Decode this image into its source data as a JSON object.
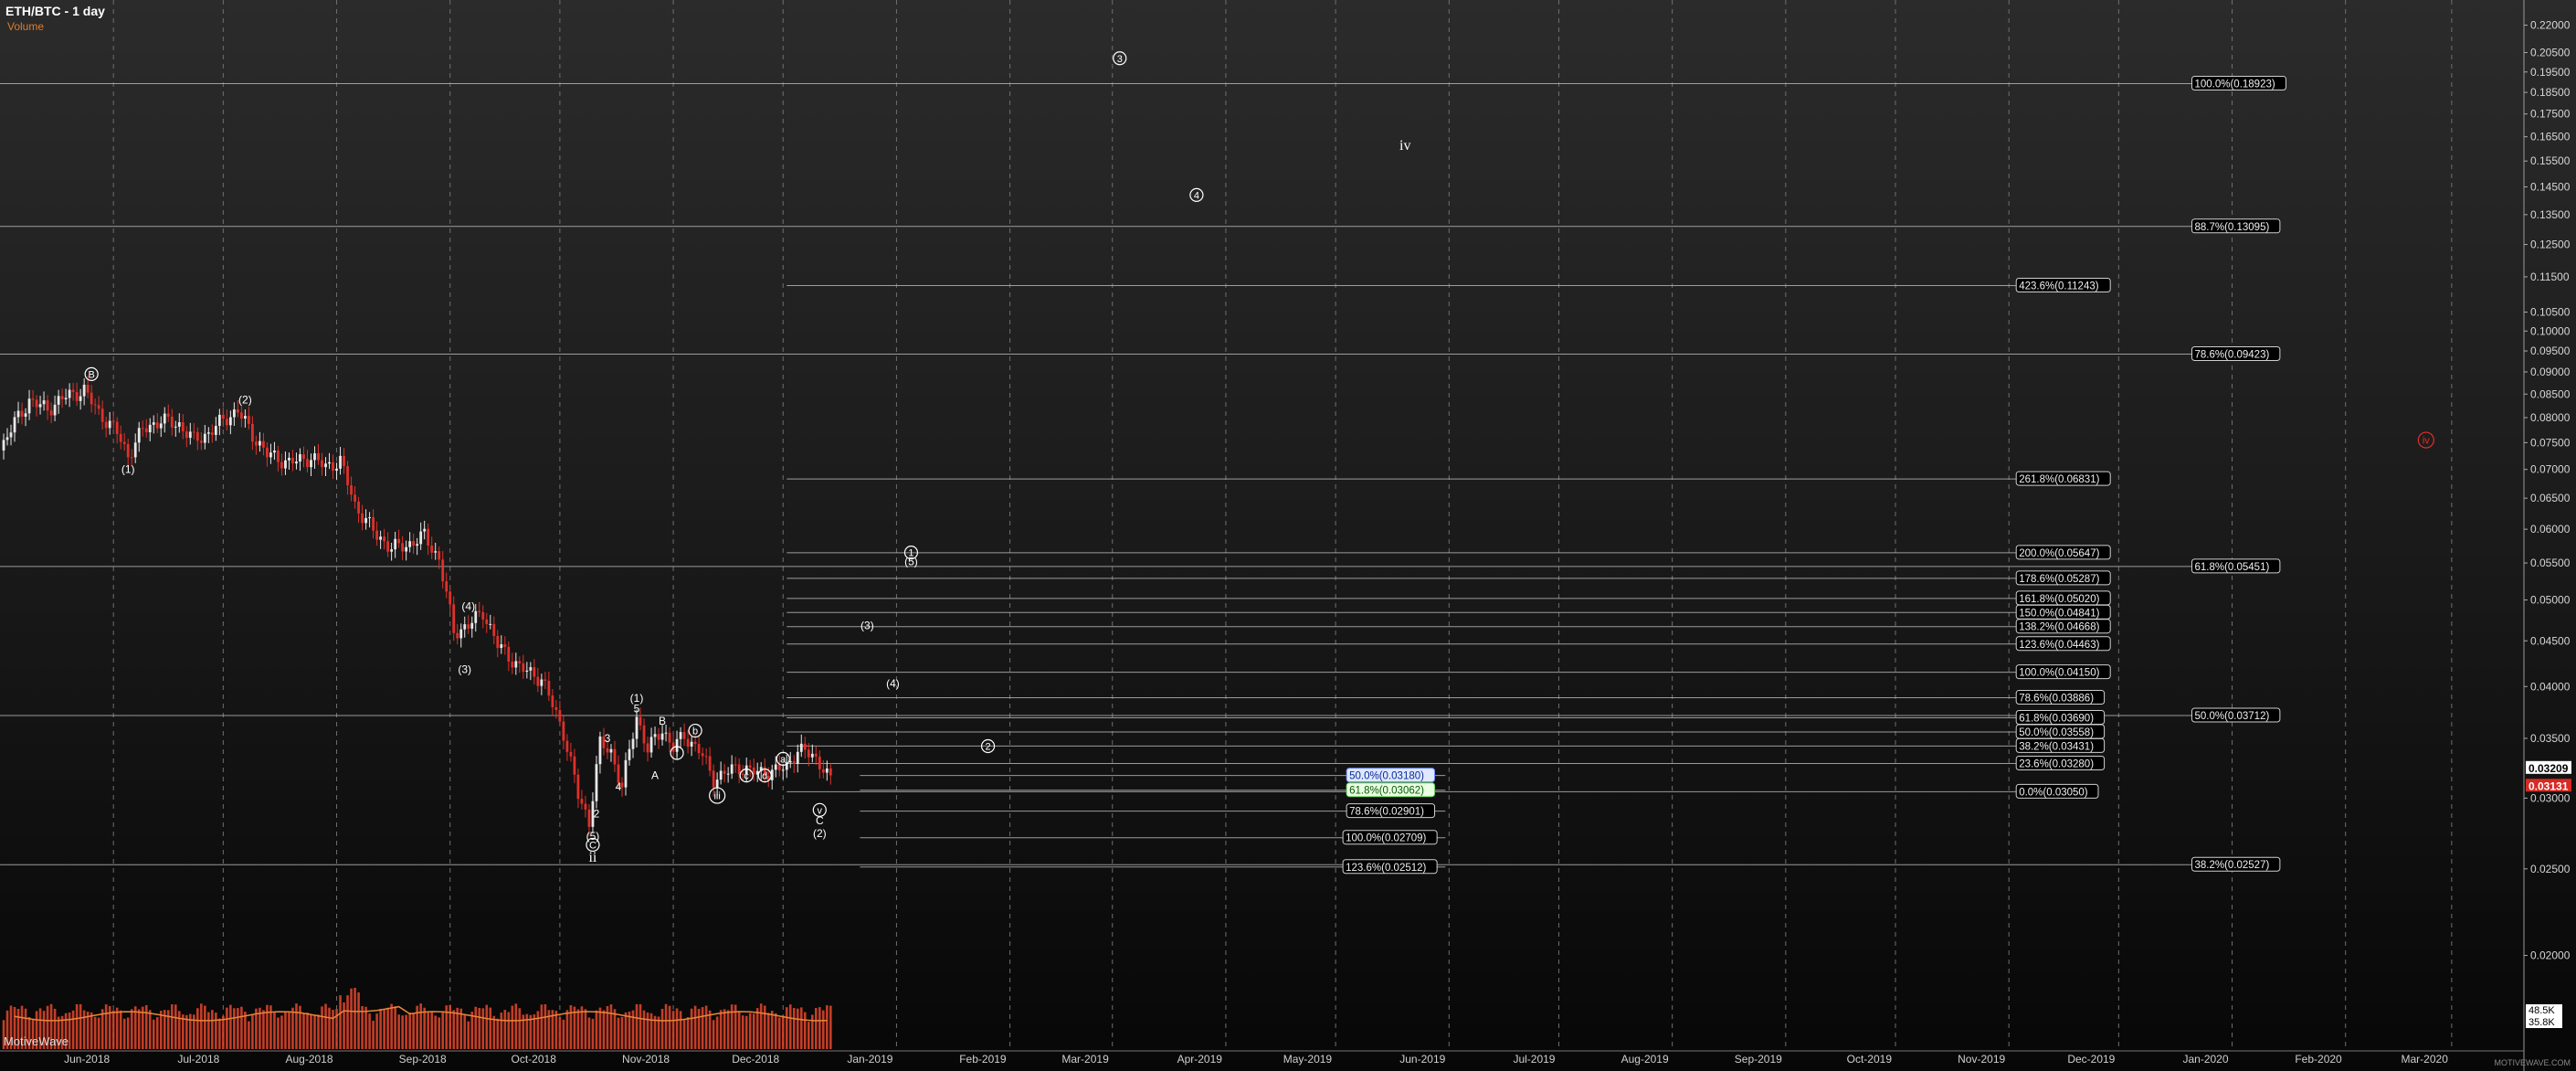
{
  "header": {
    "title": "ETH/BTC - 1 day",
    "volume_label": "Volume"
  },
  "watermark": "MotiveWave",
  "brand": "MOTIVEWAVE.COM",
  "colors": {
    "up": "#e8e8e8",
    "down": "#e0302a",
    "volume": "#d9452b",
    "ma": "#e8873a",
    "grid": "#6f6f6f",
    "fib": "#bdbdbd",
    "red_label": "#e0302a"
  },
  "chart_data": {
    "type": "candlestick",
    "x_axis": {
      "ticks": [
        "Jun-2018",
        "Jul-2018",
        "Aug-2018",
        "Sep-2018",
        "Oct-2018",
        "Nov-2018",
        "Dec-2018",
        "Jan-2019",
        "Feb-2019",
        "Mar-2019",
        "Apr-2019",
        "May-2019",
        "Jun-2019",
        "Jul-2019",
        "Aug-2019",
        "Sep-2019",
        "Oct-2019",
        "Nov-2019",
        "Dec-2019",
        "Jan-2020",
        "Feb-2020",
        "Mar-2020"
      ],
      "range": [
        "2018-05-01",
        "2020-03-20"
      ]
    },
    "y_axis": {
      "scale": "log",
      "range": [
        0.0178,
        0.232
      ],
      "ticks": [
        "0.22000",
        "0.20500",
        "0.19500",
        "0.18500",
        "0.17500",
        "0.16500",
        "0.15500",
        "0.14500",
        "0.13500",
        "0.12500",
        "0.11500",
        "0.10500",
        "0.10000",
        "0.09500",
        "0.09000",
        "0.08500",
        "0.08000",
        "0.07500",
        "0.07000",
        "0.06500",
        "0.06000",
        "0.05500",
        "0.05000",
        "0.04500",
        "0.04000",
        "0.03500",
        "0.03000",
        "0.02500",
        "0.02000"
      ],
      "price_labels": [
        {
          "text": "0.03209",
          "value": 0.03209,
          "style": "white"
        },
        {
          "text": "0.03131",
          "value": 0.03131,
          "style": "red"
        }
      ]
    },
    "price_path": [
      [
        "2018-05-01",
        0.0735
      ],
      [
        "2018-05-05",
        0.079
      ],
      [
        "2018-05-09",
        0.0835
      ],
      [
        "2018-05-14",
        0.0818
      ],
      [
        "2018-05-19",
        0.0845
      ],
      [
        "2018-05-24",
        0.0858
      ],
      [
        "2018-05-28",
        0.081
      ],
      [
        "2018-06-02",
        0.077
      ],
      [
        "2018-06-05",
        0.0725
      ],
      [
        "2018-06-09",
        0.0775
      ],
      [
        "2018-06-14",
        0.0795
      ],
      [
        "2018-06-19",
        0.0785
      ],
      [
        "2018-06-23",
        0.0755
      ],
      [
        "2018-06-27",
        0.0768
      ],
      [
        "2018-07-01",
        0.0795
      ],
      [
        "2018-07-05",
        0.0815
      ],
      [
        "2018-07-09",
        0.0765
      ],
      [
        "2018-07-13",
        0.0728
      ],
      [
        "2018-07-19",
        0.0712
      ],
      [
        "2018-07-25",
        0.0722
      ],
      [
        "2018-07-29",
        0.0705
      ],
      [
        "2018-08-02",
        0.0715
      ],
      [
        "2018-08-06",
        0.0638
      ],
      [
        "2018-08-12",
        0.059
      ],
      [
        "2018-08-16",
        0.0572
      ],
      [
        "2018-08-20",
        0.0575
      ],
      [
        "2018-08-25",
        0.059
      ],
      [
        "2018-08-29",
        0.0555
      ],
      [
        "2018-09-02",
        0.046
      ],
      [
        "2018-09-06",
        0.0468
      ],
      [
        "2018-09-10",
        0.0485
      ],
      [
        "2018-09-14",
        0.0445
      ],
      [
        "2018-09-20",
        0.042
      ],
      [
        "2018-09-26",
        0.0408
      ],
      [
        "2018-10-02",
        0.0355
      ],
      [
        "2018-10-06",
        0.0302
      ],
      [
        "2018-10-09",
        0.0282
      ],
      [
        "2018-10-12",
        0.0345
      ],
      [
        "2018-10-15",
        0.0338
      ],
      [
        "2018-10-18",
        0.0308
      ],
      [
        "2018-10-22",
        0.037
      ],
      [
        "2018-10-25",
        0.034
      ],
      [
        "2018-10-29",
        0.0358
      ],
      [
        "2018-11-01",
        0.0342
      ],
      [
        "2018-11-04",
        0.0352
      ],
      [
        "2018-11-08",
        0.034
      ],
      [
        "2018-11-12",
        0.0315
      ],
      [
        "2018-11-15",
        0.032
      ],
      [
        "2018-11-19",
        0.0325
      ],
      [
        "2018-11-24",
        0.032
      ],
      [
        "2018-11-29",
        0.0322
      ],
      [
        "2018-12-02",
        0.0325
      ],
      [
        "2018-12-05",
        0.034
      ],
      [
        "2018-12-09",
        0.0335
      ],
      [
        "2018-12-12",
        0.0325
      ],
      [
        "2018-12-14",
        0.0313
      ]
    ],
    "volume_panel": {
      "right_labels": [
        "48.5K",
        "35.8K"
      ]
    },
    "fib_levels": [
      {
        "label": "100.0%(0.18923)",
        "value": 0.18923,
        "start": "2018-05-01",
        "end": "2019-12-28",
        "tag": "2019-12-21"
      },
      {
        "label": "88.7%(0.13095)",
        "value": 0.13095,
        "start": "2018-05-01",
        "end": "2019-12-28",
        "tag": "2019-12-21"
      },
      {
        "label": "78.6%(0.09423)",
        "value": 0.09423,
        "start": "2018-05-01",
        "end": "2019-12-28",
        "tag": "2019-12-21"
      },
      {
        "label": "61.8%(0.05451)",
        "value": 0.05451,
        "start": "2018-05-01",
        "end": "2019-12-28",
        "tag": "2019-12-21"
      },
      {
        "label": "50.0%(0.03712)",
        "value": 0.03712,
        "start": "2018-05-01",
        "end": "2019-12-28",
        "tag": "2019-12-21"
      },
      {
        "label": "38.2%(0.02527)",
        "value": 0.02527,
        "start": "2018-05-01",
        "end": "2019-12-28",
        "tag": "2019-12-21"
      },
      {
        "label": "423.6%(0.11243)",
        "value": 0.11243,
        "start": "2018-12-02",
        "end": "2019-11-14",
        "tag": "2019-11-03"
      },
      {
        "label": "261.8%(0.06831)",
        "value": 0.06831,
        "start": "2018-12-02",
        "end": "2019-11-14",
        "tag": "2019-11-03"
      },
      {
        "label": "200.0%(0.05647)",
        "value": 0.05647,
        "start": "2018-12-02",
        "end": "2019-11-14",
        "tag": "2019-11-03"
      },
      {
        "label": "178.6%(0.05287)",
        "value": 0.05287,
        "start": "2018-12-02",
        "end": "2019-11-14",
        "tag": "2019-11-03"
      },
      {
        "label": "161.8%(0.05020)",
        "value": 0.0502,
        "start": "2018-12-02",
        "end": "2019-11-14",
        "tag": "2019-11-03"
      },
      {
        "label": "150.0%(0.04841)",
        "value": 0.04841,
        "start": "2018-12-02",
        "end": "2019-11-14",
        "tag": "2019-11-03"
      },
      {
        "label": "138.2%(0.04668)",
        "value": 0.04668,
        "start": "2018-12-02",
        "end": "2019-11-14",
        "tag": "2019-11-03"
      },
      {
        "label": "123.6%(0.04463)",
        "value": 0.04463,
        "start": "2018-12-02",
        "end": "2019-11-14",
        "tag": "2019-11-03"
      },
      {
        "label": "100.0%(0.04150)",
        "value": 0.0415,
        "start": "2018-12-02",
        "end": "2019-11-14",
        "tag": "2019-11-03"
      },
      {
        "label": "78.6%(0.03886)",
        "value": 0.03886,
        "start": "2018-12-02",
        "end": "2019-11-14",
        "tag": "2019-11-03"
      },
      {
        "label": "61.8%(0.03690)",
        "value": 0.0369,
        "start": "2018-12-02",
        "end": "2019-11-14",
        "tag": "2019-11-03"
      },
      {
        "label": "50.0%(0.03558)",
        "value": 0.03558,
        "start": "2018-12-02",
        "end": "2019-11-14",
        "tag": "2019-11-03"
      },
      {
        "label": "38.2%(0.03431)",
        "value": 0.03431,
        "start": "2018-12-02",
        "end": "2019-11-14",
        "tag": "2019-11-03"
      },
      {
        "label": "23.6%(0.03280)",
        "value": 0.0328,
        "start": "2018-12-02",
        "end": "2019-11-14",
        "tag": "2019-11-03"
      },
      {
        "label": "0.0%(0.03050)",
        "value": 0.0305,
        "start": "2018-12-02",
        "end": "2019-11-14",
        "tag": "2019-11-03"
      },
      {
        "label": "50.0%(0.03180)",
        "value": 0.0318,
        "start": "2018-12-22",
        "end": "2019-05-31",
        "tag": "2019-05-04",
        "style": "blue"
      },
      {
        "label": "61.8%(0.03062)",
        "value": 0.03062,
        "start": "2018-12-22",
        "end": "2019-05-31",
        "tag": "2019-05-04",
        "style": "green"
      },
      {
        "label": "78.6%(0.02901)",
        "value": 0.02901,
        "start": "2018-12-22",
        "end": "2019-05-31",
        "tag": "2019-05-04"
      },
      {
        "label": "100.0%(0.02709)",
        "value": 0.02709,
        "start": "2018-12-22",
        "end": "2019-05-31",
        "tag": "2019-05-03"
      },
      {
        "label": "123.6%(0.02512)",
        "value": 0.02512,
        "start": "2018-12-22",
        "end": "2019-05-31",
        "tag": "2019-05-03"
      }
    ],
    "wave_labels": [
      {
        "text": "B",
        "circled": true,
        "date": "2018-05-26",
        "value": 0.0895
      },
      {
        "text": "(2)",
        "date": "2018-07-07",
        "value": 0.0838
      },
      {
        "text": "(1)",
        "date": "2018-06-05",
        "value": 0.07
      },
      {
        "text": "(4)",
        "date": "2018-09-06",
        "value": 0.0492
      },
      {
        "text": "(3)",
        "date": "2018-09-05",
        "value": 0.0418
      },
      {
        "text": "(1)",
        "date": "2018-10-22",
        "value": 0.0388
      },
      {
        "text": "5",
        "date": "2018-10-22",
        "value": 0.0378
      },
      {
        "text": "B",
        "date": "2018-10-29",
        "value": 0.0366
      },
      {
        "text": "b",
        "circled": true,
        "date": "2018-11-07",
        "value": 0.0357
      },
      {
        "text": "3",
        "date": "2018-10-14",
        "value": 0.035
      },
      {
        "text": "i",
        "circled": true,
        "date": "2018-11-02",
        "value": 0.0337
      },
      {
        "text": "a",
        "circled": true,
        "date": "2018-12-01",
        "value": 0.0332
      },
      {
        "text": "A",
        "date": "2018-10-27",
        "value": 0.0318
      },
      {
        "text": "4",
        "date": "2018-10-17",
        "value": 0.0309
      },
      {
        "text": "2",
        "date": "2018-10-11",
        "value": 0.0288
      },
      {
        "text": "iii",
        "circled": true,
        "date": "2018-11-13",
        "value": 0.0302
      },
      {
        "text": "c",
        "circled": true,
        "date": "2018-11-21",
        "value": 0.0318
      },
      {
        "text": "d",
        "circled": true,
        "date": "2018-11-26",
        "value": 0.0318
      },
      {
        "text": "(5)",
        "date": "2018-10-10",
        "value": 0.0272
      },
      {
        "text": "C",
        "circled": true,
        "date": "2018-10-10",
        "value": 0.0266
      },
      {
        "text": "ii",
        "serif": true,
        "date": "2018-10-10",
        "value": 0.0257
      },
      {
        "text": "3",
        "circled": true,
        "date": "2019-03-03",
        "value": 0.202
      },
      {
        "text": "iv",
        "serif": true,
        "date": "2019-05-20",
        "value": 0.161
      },
      {
        "text": "4",
        "circled": true,
        "date": "2019-03-24",
        "value": 0.142
      },
      {
        "text": "1",
        "circled": true,
        "date": "2019-01-05",
        "value": 0.0565
      },
      {
        "text": "(5)",
        "date": "2019-01-05",
        "value": 0.0552
      },
      {
        "text": "(3)",
        "date": "2018-12-24",
        "value": 0.0468
      },
      {
        "text": "(4)",
        "date": "2018-12-31",
        "value": 0.0403
      },
      {
        "text": "2",
        "circled": true,
        "date": "2019-01-26",
        "value": 0.0343
      },
      {
        "text": "v",
        "circled": true,
        "date": "2018-12-11",
        "value": 0.0291
      },
      {
        "text": "C",
        "date": "2018-12-11",
        "value": 0.0283
      },
      {
        "text": "(2)",
        "date": "2018-12-11",
        "value": 0.0274
      },
      {
        "text": "iv",
        "circled": true,
        "red": true,
        "date": "2020-02-23",
        "value": 0.0755
      }
    ]
  }
}
